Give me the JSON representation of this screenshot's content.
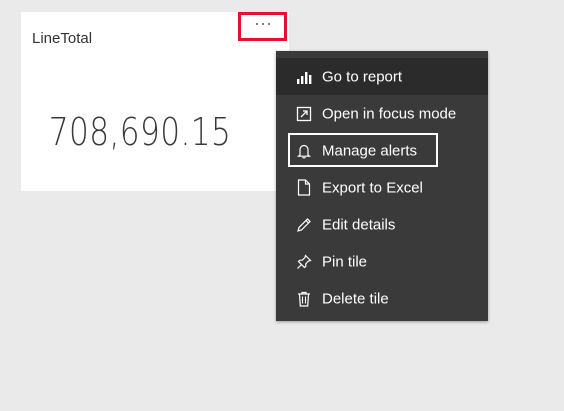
{
  "tile": {
    "title": "LineTotal",
    "value": "708,690.15",
    "more_options_icon": "ellipsis-icon"
  },
  "menu": {
    "items": [
      {
        "label": "Go to report",
        "icon": "bar-chart-icon",
        "active": true
      },
      {
        "label": "Open in focus mode",
        "icon": "focus-mode-icon",
        "active": false
      },
      {
        "label": "Manage alerts",
        "icon": "bell-icon",
        "active": false,
        "highlighted": true
      },
      {
        "label": "Export to Excel",
        "icon": "export-document-icon",
        "active": false
      },
      {
        "label": "Edit details",
        "icon": "pencil-icon",
        "active": false
      },
      {
        "label": "Pin tile",
        "icon": "pin-icon",
        "active": false
      },
      {
        "label": "Delete tile",
        "icon": "trash-icon",
        "active": false
      }
    ]
  },
  "colors": {
    "page_background": "#eaeaea",
    "menu_background": "#3a3a3a",
    "menu_active_background": "#2b2b2b",
    "highlight_red": "#e8112d",
    "highlight_white": "#ffffff"
  }
}
